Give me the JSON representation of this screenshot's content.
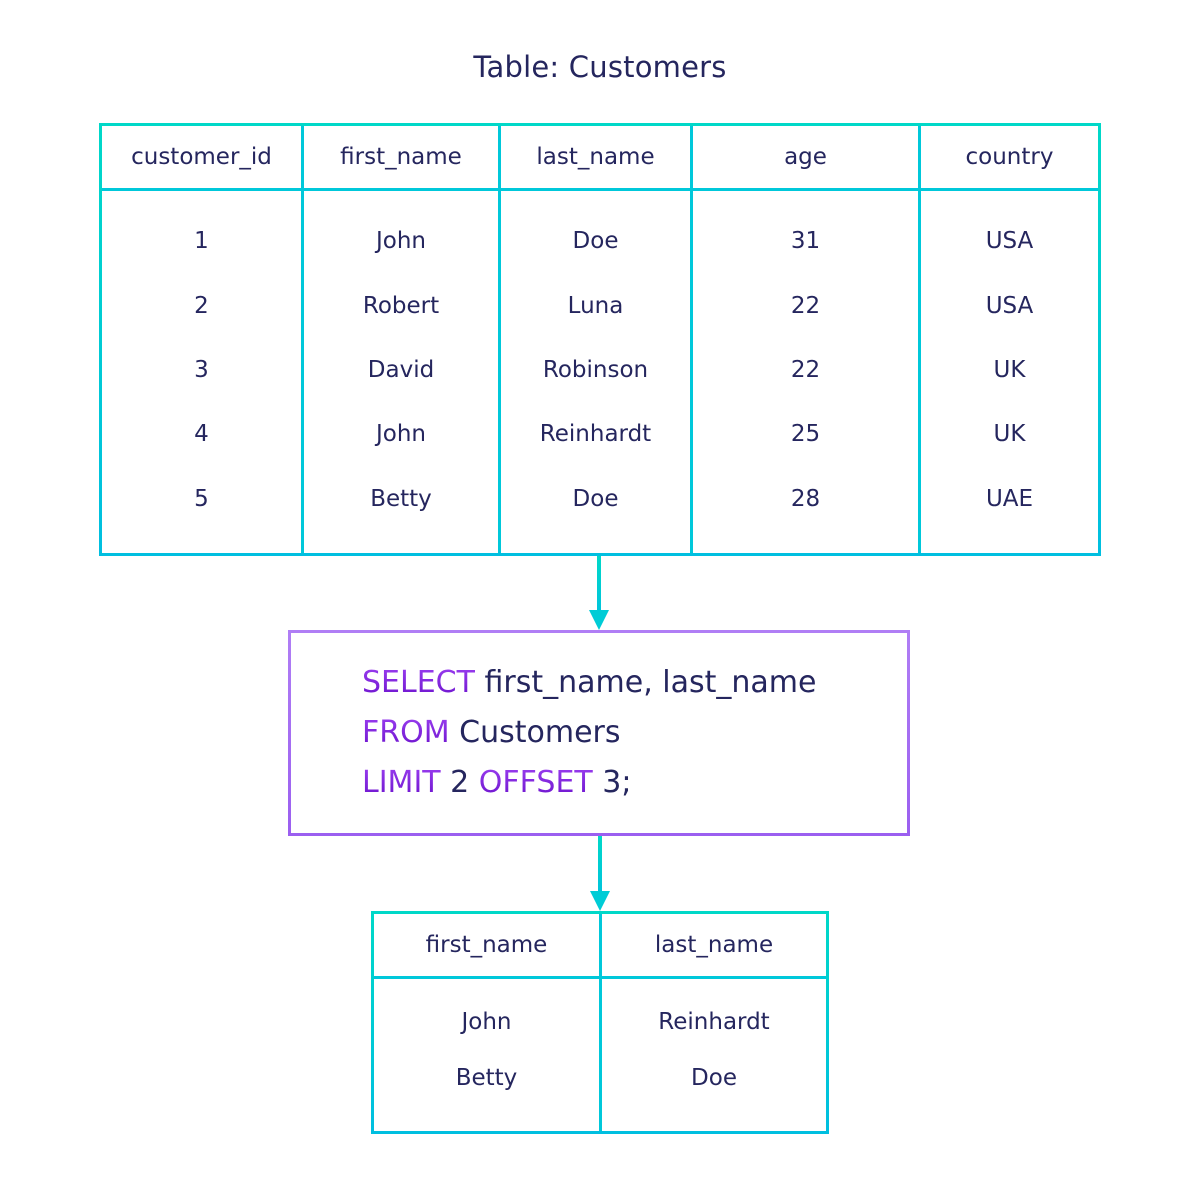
{
  "title": "Table: Customers",
  "source_table": {
    "name": "Customers",
    "columns": [
      "customer_id",
      "first_name",
      "last_name",
      "age",
      "country"
    ],
    "rows": [
      [
        "1",
        "John",
        "Doe",
        "31",
        "USA"
      ],
      [
        "2",
        "Robert",
        "Luna",
        "22",
        "USA"
      ],
      [
        "3",
        "David",
        "Robinson",
        "22",
        "UK"
      ],
      [
        "4",
        "John",
        "Reinhardt",
        "25",
        "UK"
      ],
      [
        "5",
        "Betty",
        "Doe",
        "28",
        "UAE"
      ]
    ]
  },
  "query": {
    "lines": [
      [
        {
          "text": "SELECT",
          "kw": true
        },
        {
          "text": " first_name, last_name",
          "kw": false
        }
      ],
      [
        {
          "text": "FROM",
          "kw": true
        },
        {
          "text": " Customers",
          "kw": false
        }
      ],
      [
        {
          "text": "LIMIT",
          "kw": true
        },
        {
          "text": " 2 ",
          "kw": false
        },
        {
          "text": "OFFSET",
          "kw": true
        },
        {
          "text": " 3;",
          "kw": false
        }
      ]
    ]
  },
  "result_table": {
    "columns": [
      "first_name",
      "last_name"
    ],
    "rows": [
      [
        "John",
        "Reinhardt"
      ],
      [
        "Betty",
        "Doe"
      ]
    ]
  },
  "colors": {
    "text": "#25265e",
    "table_border": "#00cfd4",
    "query_border": "#a36cf0",
    "keyword": "#7a22de"
  }
}
